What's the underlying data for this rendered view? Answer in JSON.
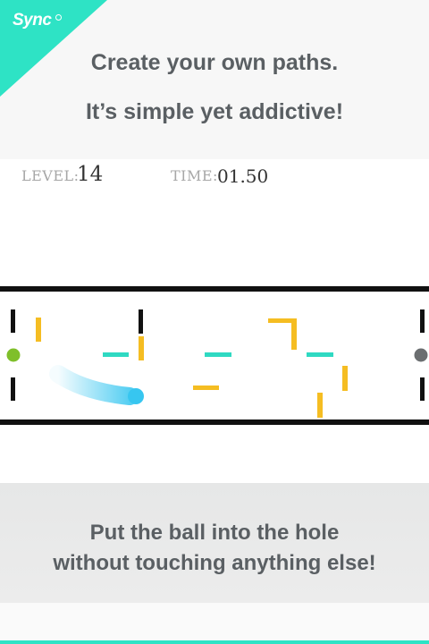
{
  "brand": {
    "logo_text": "Sync",
    "accent_color": "#2ee3c5"
  },
  "header": {
    "line1": "Create your own paths.",
    "line2": "It’s simple yet addictive!"
  },
  "hud": {
    "level_label": "LEVEL:",
    "level_value": "14",
    "time_label": "TIME:",
    "time_value": "01.50"
  },
  "game": {
    "ball_color": "#37c6f0",
    "start_dot_color": "#7fbf2a",
    "hole_color": "#6b6e70",
    "barrier_colors": {
      "yellow": "#f5bd22",
      "teal": "#2fd9c2",
      "black": "#111111"
    }
  },
  "footer": {
    "line1": "Put the ball into the hole",
    "line2": "without touching anything else!"
  }
}
